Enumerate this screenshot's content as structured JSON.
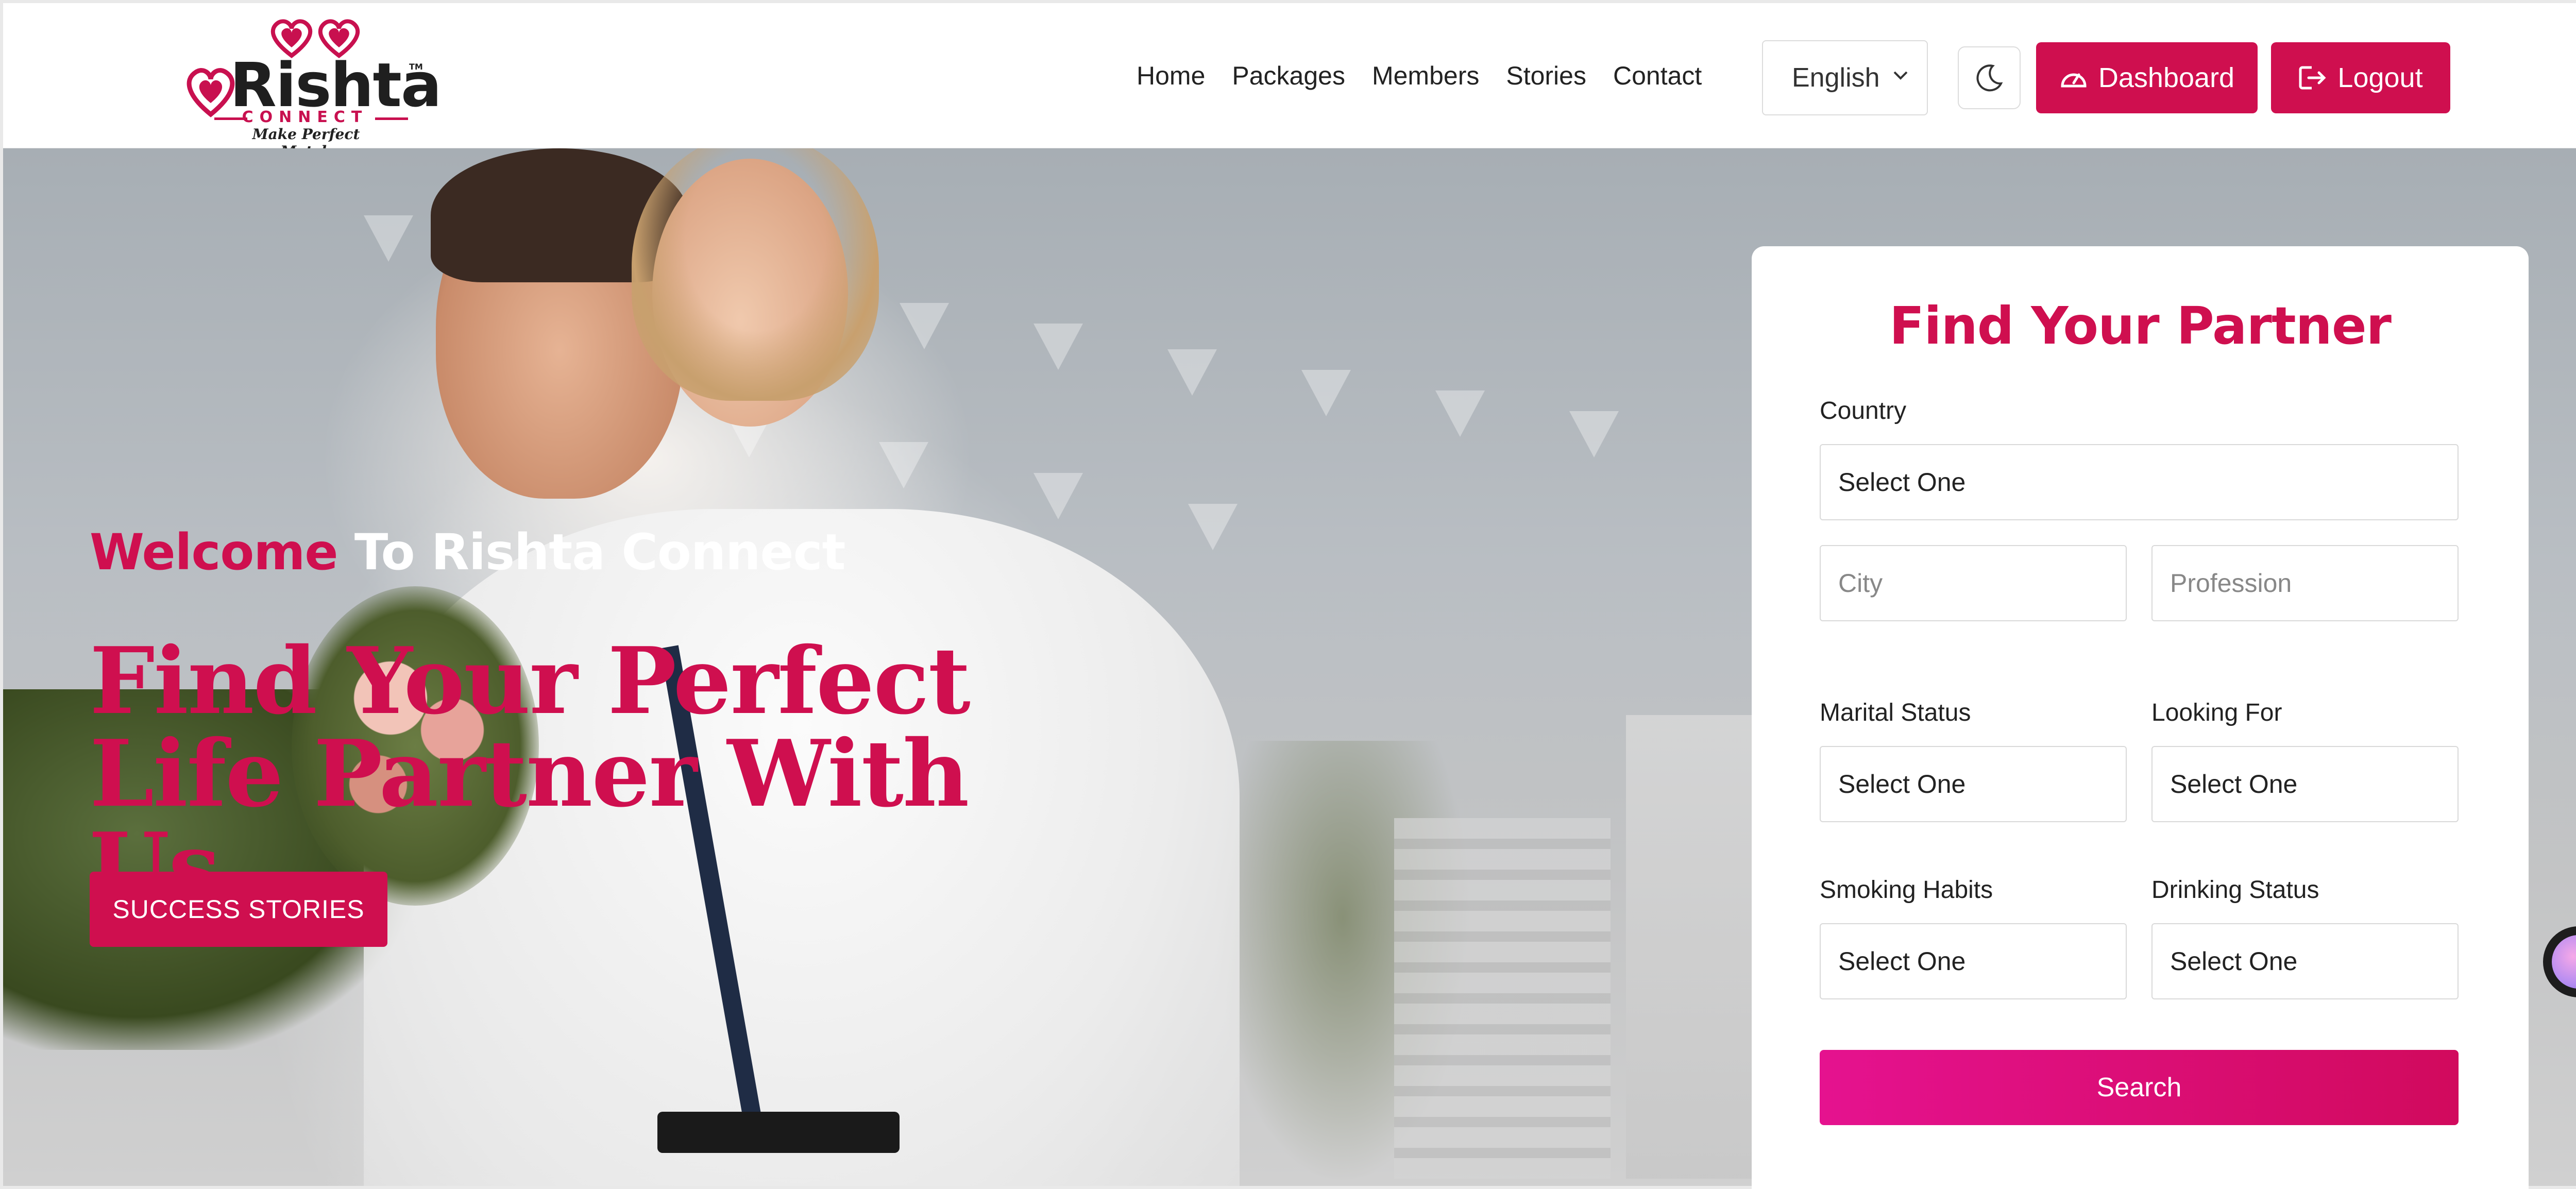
{
  "brand": {
    "name": "Rishta",
    "sub": "CONNECT",
    "tagline": "Make Perfect Match",
    "tm": "TM"
  },
  "nav": {
    "items": [
      {
        "label": "Home"
      },
      {
        "label": "Packages"
      },
      {
        "label": "Members"
      },
      {
        "label": "Stories"
      },
      {
        "label": "Contact"
      }
    ],
    "language": "English",
    "theme_icon": "moon-icon",
    "dashboard_label": "Dashboard",
    "logout_label": "Logout"
  },
  "hero": {
    "welcome_pink": "Welcome",
    "welcome_white": " To Rishta Connect",
    "title": "Find Your Perfect Life Partner With Us",
    "cta_label": "SUCCESS STORIES"
  },
  "search": {
    "title": "Find Your Partner",
    "country": {
      "label": "Country",
      "value": "Select One"
    },
    "city": {
      "placeholder": "City"
    },
    "profession": {
      "placeholder": "Profession"
    },
    "marital_status": {
      "label": "Marital Status",
      "value": "Select One"
    },
    "looking_for": {
      "label": "Looking For",
      "value": "Select One"
    },
    "smoking_habits": {
      "label": "Smoking Habits",
      "value": "Select One"
    },
    "drinking_status": {
      "label": "Drinking Status",
      "value": "Select One"
    },
    "button_label": "Search"
  },
  "colors": {
    "accent": "#cf0f4f",
    "search_gradient_start": "#e5128f",
    "search_gradient_end": "#d10a5d"
  }
}
